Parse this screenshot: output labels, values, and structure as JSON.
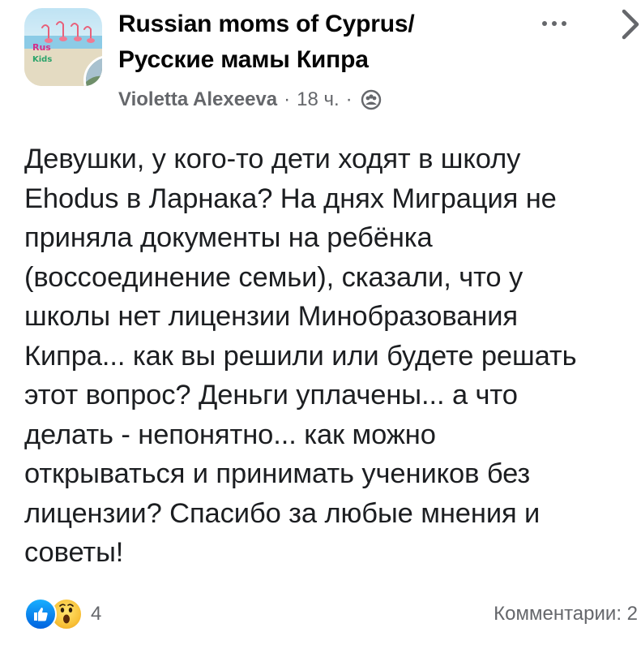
{
  "group": {
    "name_line1": "Russian moms of Cyprus/",
    "name_line2": "Русские мамы Кипра"
  },
  "meta": {
    "author": "Violetta Alexeeva",
    "separator": "·",
    "time": "18 ч.",
    "audience_icon": "group-audience-icon"
  },
  "post": {
    "lines": [
      "Девушки, у кого-то дети ходят в школу",
      "Ehodus в Ларнака? На днях Миграция не",
      "приняла документы на ребёнка",
      "(воссоединение семьи), сказали, что у",
      "школы нет лицензии Минобразования",
      "Кипра... как вы решили или будете решать",
      "этот вопрос? Деньги уплачены... а что",
      "делать - непонятно... как можно",
      "открываться и принимать учеников без",
      "лицензии? Спасибо за любые мнения и",
      "советы!"
    ]
  },
  "footer": {
    "reaction_icons": [
      "like-icon",
      "wow-icon"
    ],
    "reaction_count": "4",
    "comments": "Комментарии: 2"
  },
  "colors": {
    "text": "#1c1e21",
    "secondary": "#65676b",
    "like_blue": "#0866ff",
    "wow_yellow": "#f9c33a"
  }
}
